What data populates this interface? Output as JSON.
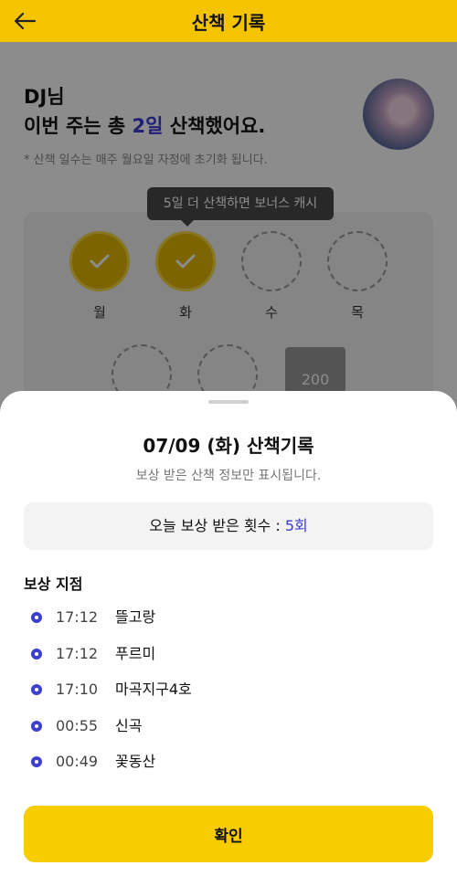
{
  "header": {
    "title": "산책 기록",
    "back_icon": "back-arrow-icon"
  },
  "summary": {
    "name": "DJ님",
    "line2_prefix": "이번 주는 총 ",
    "days_count": "2일",
    "line2_suffix": " 산책했어요.",
    "note": "* 산책 일수는 매주 월요일 자정에 초기화 됩니다."
  },
  "tooltip": "5일 더 산책하면 보너스 캐시",
  "week": {
    "days": [
      {
        "label": "월",
        "done": true
      },
      {
        "label": "화",
        "done": true
      },
      {
        "label": "수",
        "done": false
      },
      {
        "label": "목",
        "done": false
      },
      {
        "label": "",
        "done": false
      },
      {
        "label": "",
        "done": false
      }
    ],
    "bonus": "200"
  },
  "sheet": {
    "title": "07/09 (화) 산책기록",
    "subtitle": "보상 받은 산책 정보만 표시됩니다.",
    "count_label": "오늘 보상 받은 횟수 : ",
    "count_value": "5회",
    "section_title": "보상 지점",
    "points": [
      {
        "time": "17:12",
        "place": "뜰고랑"
      },
      {
        "time": "17:12",
        "place": "푸르미"
      },
      {
        "time": "17:10",
        "place": "마곡지구4호"
      },
      {
        "time": "00:55",
        "place": "신곡"
      },
      {
        "time": "00:49",
        "place": "꽃동산"
      }
    ],
    "confirm_label": "확인"
  },
  "colors": {
    "accent": "#f4c400",
    "highlight": "#3a3ad6",
    "button": "#f7cd00"
  }
}
